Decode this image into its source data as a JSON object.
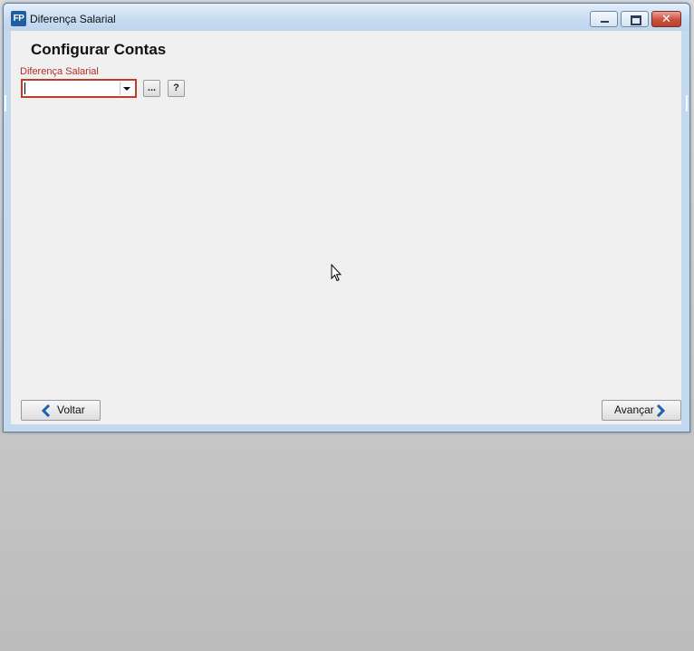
{
  "window": {
    "title": "Diferença Salarial",
    "app_icon_text": "FP",
    "close_glyph": "✕"
  },
  "main": {
    "heading": "Configurar Contas",
    "field_label": "Diferença Salarial",
    "combo_value": "",
    "dots_label": "...",
    "help_label": "?"
  },
  "footer": {
    "back_label": "Voltar",
    "next_label": "Avançar"
  },
  "icons": {
    "back": "chevron-left-icon",
    "next": "chevron-right-icon",
    "cursor": "mouse-pointer-icon"
  },
  "colors": {
    "accent_blue": "#1f5f9f",
    "error_red": "#c23a2c",
    "label_red": "#b0302a",
    "chevron_blue": "#1b62b3"
  }
}
